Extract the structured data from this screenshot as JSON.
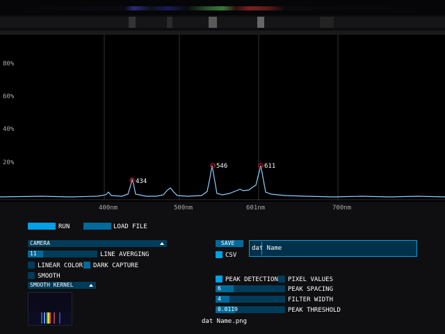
{
  "plot": {
    "y_ticks": [
      "80%",
      "60%",
      "40%",
      "20%"
    ],
    "x_ticks": [
      "400nm",
      "500nm",
      "601nm",
      "700nm"
    ],
    "peaks": [
      "434",
      "546",
      "611"
    ]
  },
  "controls": {
    "run_label": "RUN",
    "load_file_label": "LOAD FILE",
    "source_dropdown": "CAMERA",
    "line_averaging_value": "11",
    "line_averaging_label": "LINE AVERGING",
    "linear_color_label": "LINEAR COLOR",
    "dark_capture_label": "DARK CAPTURE",
    "smooth_label": "SMOOTH",
    "smooth_kernel_dropdown": "SMOOTH KERNEL",
    "save_label": "SAVE",
    "csv_label": "CSV",
    "filename_value": "dat Name",
    "peak_detection_label": "PEAK DETECTION",
    "pixel_values_label": "PIXEL VALUES",
    "peak_spacing_value": "6",
    "peak_spacing_label": "PEAK SPACING",
    "filter_width_value": "4",
    "filter_width_label": "FILTER WIDTH",
    "peak_threshold_value": "0.0119",
    "peak_threshold_label": "PEAK THRESHOLD",
    "output_filename": "dat Name.png"
  },
  "colors": {
    "accent": "#00a0e6",
    "accent_dark": "#006a9a",
    "control_bg": "#003b5a",
    "peak_marker": "#cc2222"
  }
}
